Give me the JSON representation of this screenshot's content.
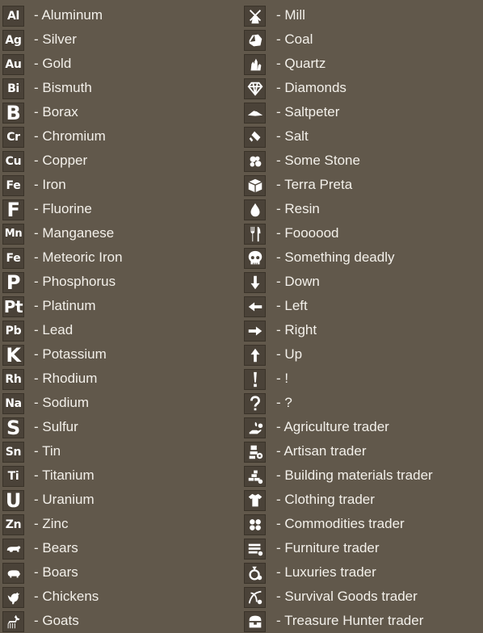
{
  "left_column": [
    {
      "symbol": "Al",
      "label": "- Aluminum",
      "icon": "element-symbol"
    },
    {
      "symbol": "Ag",
      "label": "- Silver",
      "icon": "element-symbol"
    },
    {
      "symbol": "Au",
      "label": "- Gold",
      "icon": "element-symbol"
    },
    {
      "symbol": "Bi",
      "label": "- Bismuth",
      "icon": "element-symbol"
    },
    {
      "symbol": "B",
      "label": "- Borax",
      "icon": "element-symbol"
    },
    {
      "symbol": "Cr",
      "label": "- Chromium",
      "icon": "element-symbol"
    },
    {
      "symbol": "Cu",
      "label": "- Copper",
      "icon": "element-symbol"
    },
    {
      "symbol": "Fe",
      "label": "- Iron",
      "icon": "element-symbol"
    },
    {
      "symbol": "F",
      "label": "- Fluorine",
      "icon": "element-symbol"
    },
    {
      "symbol": "Mn",
      "label": "- Manganese",
      "icon": "element-symbol"
    },
    {
      "symbol": "Fe",
      "label": "- Meteoric Iron",
      "icon": "element-symbol-meteoric"
    },
    {
      "symbol": "P",
      "label": "- Phosphorus",
      "icon": "element-symbol"
    },
    {
      "symbol": "Pt",
      "label": "- Platinum",
      "icon": "element-symbol"
    },
    {
      "symbol": "Pb",
      "label": "- Lead",
      "icon": "element-symbol"
    },
    {
      "symbol": "K",
      "label": "- Potassium",
      "icon": "element-symbol"
    },
    {
      "symbol": "Rh",
      "label": "- Rhodium",
      "icon": "element-symbol"
    },
    {
      "symbol": "Na",
      "label": "- Sodium",
      "icon": "element-symbol"
    },
    {
      "symbol": "S",
      "label": "- Sulfur",
      "icon": "element-symbol"
    },
    {
      "symbol": "Sn",
      "label": "- Tin",
      "icon": "element-symbol"
    },
    {
      "symbol": "Ti",
      "label": "- Titanium",
      "icon": "element-symbol"
    },
    {
      "symbol": "U",
      "label": "- Uranium",
      "icon": "element-symbol"
    },
    {
      "symbol": "Zn",
      "label": "- Zinc",
      "icon": "element-symbol"
    },
    {
      "symbol": "",
      "label": "- Bears",
      "icon": "bear-icon"
    },
    {
      "symbol": "",
      "label": "- Boars",
      "icon": "boar-icon"
    },
    {
      "symbol": "",
      "label": "- Chickens",
      "icon": "chicken-icon"
    },
    {
      "symbol": "",
      "label": "- Goats",
      "icon": "goat-icon"
    }
  ],
  "right_column": [
    {
      "label": "- Mill",
      "icon": "windmill-icon"
    },
    {
      "label": "- Coal",
      "icon": "coal-icon"
    },
    {
      "label": "- Quartz",
      "icon": "quartz-icon"
    },
    {
      "label": "- Diamonds",
      "icon": "diamond-icon"
    },
    {
      "label": "- Saltpeter",
      "icon": "saltpeter-icon"
    },
    {
      "label": "- Salt",
      "icon": "salt-icon"
    },
    {
      "label": "- Some Stone",
      "icon": "stone-icon"
    },
    {
      "label": "- Terra Preta",
      "icon": "terra-preta-icon"
    },
    {
      "label": "- Resin",
      "icon": "resin-drop-icon"
    },
    {
      "label": "- Foooood",
      "icon": "fork-knife-icon"
    },
    {
      "label": "- Something deadly",
      "icon": "skull-icon"
    },
    {
      "label": "- Down",
      "icon": "arrow-down-icon"
    },
    {
      "label": "- Left",
      "icon": "arrow-left-icon"
    },
    {
      "label": "- Right",
      "icon": "arrow-right-icon"
    },
    {
      "label": "- Up",
      "icon": "arrow-up-icon"
    },
    {
      "label": "- !",
      "icon": "exclamation-icon"
    },
    {
      "label": "- ?",
      "icon": "question-icon"
    },
    {
      "label": "- Agriculture trader",
      "icon": "agriculture-trader-icon"
    },
    {
      "label": "- Artisan trader",
      "icon": "artisan-trader-icon"
    },
    {
      "label": "- Building materials trader",
      "icon": "building-materials-trader-icon"
    },
    {
      "label": "- Clothing trader",
      "icon": "clothing-trader-icon"
    },
    {
      "label": "- Commodities trader",
      "icon": "commodities-trader-icon"
    },
    {
      "label": "- Furniture trader",
      "icon": "furniture-trader-icon"
    },
    {
      "label": "- Luxuries trader",
      "icon": "luxuries-trader-icon"
    },
    {
      "label": "- Survival Goods trader",
      "icon": "survival-goods-trader-icon"
    },
    {
      "label": "- Treasure Hunter trader",
      "icon": "treasure-hunter-trader-icon"
    }
  ],
  "colors": {
    "background": "#61584b",
    "icon_tile": "#4a4238",
    "text": "#f3f0ea"
  }
}
